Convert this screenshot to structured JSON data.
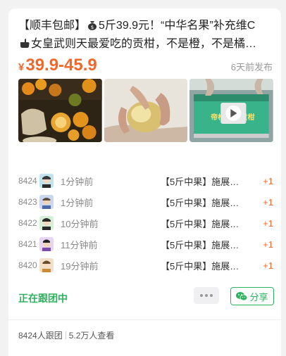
{
  "title": {
    "part1": "【顺丰包邮】",
    "part2": "5斤39.9元！“中华名果”补充维C",
    "part3": "女皇武则天最爱吃的贡柑，不是橙，不是橘…",
    "money_bag_icon": "money-bag-icon",
    "hand_icon": "pointing-hand-icon"
  },
  "price": {
    "currency": "¥",
    "range": "39.9-45.9"
  },
  "posted": "6天前发布",
  "log": [
    {
      "num": "8424",
      "time": "1分钟前",
      "item": "【5斤中果】施展…",
      "plus": "+1"
    },
    {
      "num": "8423",
      "time": "1分钟前",
      "item": "【5斤中果】施展…",
      "plus": "+1"
    },
    {
      "num": "8422",
      "time": "10分钟前",
      "item": "【5斤中果】施展…",
      "plus": "+1"
    },
    {
      "num": "8421",
      "time": "11分钟前",
      "item": "【5斤中果】施展…",
      "plus": "+1"
    },
    {
      "num": "8420",
      "time": "19分钟前",
      "item": "【5斤中果】施展…",
      "plus": "+1"
    }
  ],
  "status": "正在跟团中",
  "share_label": "分享",
  "footer": {
    "followers": "8424人跟团",
    "views": "5.2万人查看"
  },
  "colors": {
    "accent": "#f0682a",
    "green": "#2eb25f"
  }
}
